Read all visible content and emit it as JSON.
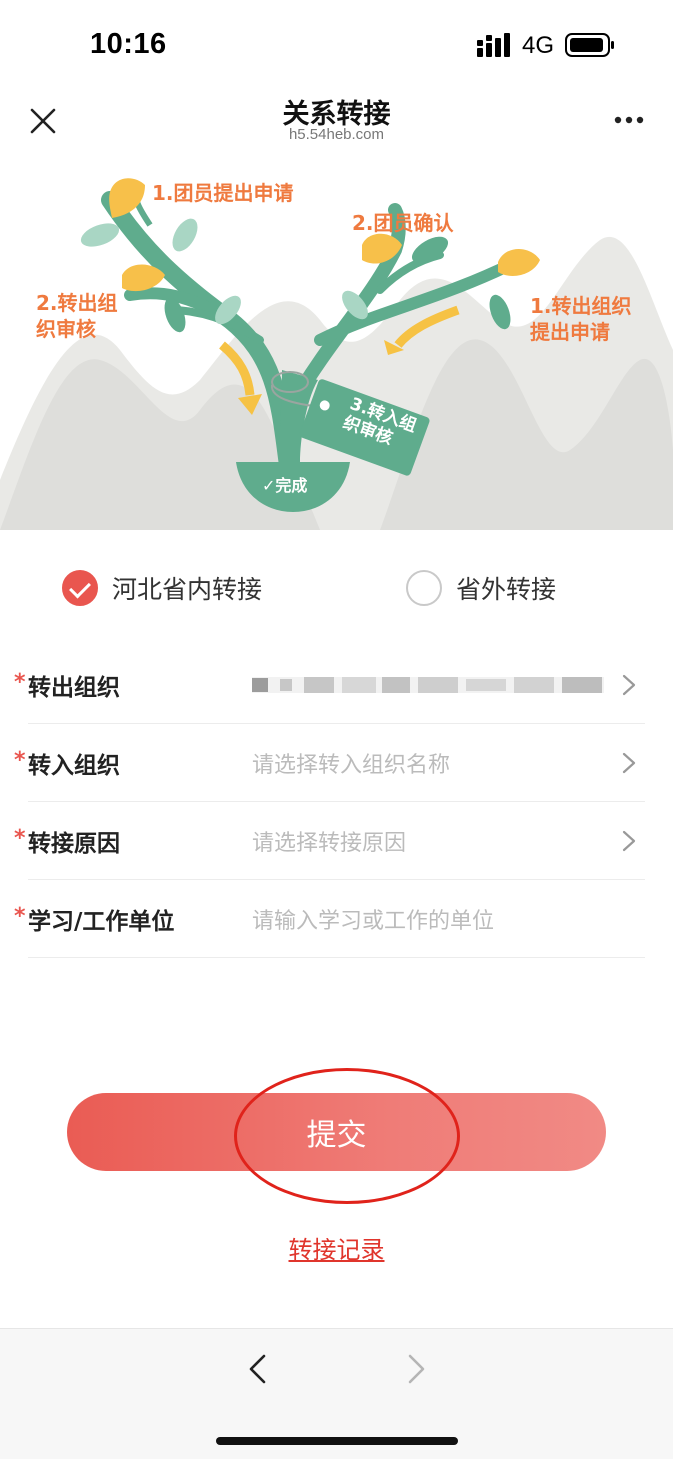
{
  "status_bar": {
    "time": "10:16",
    "network": "4G"
  },
  "nav": {
    "title": "关系转接",
    "subtitle": "h5.54heb.com"
  },
  "banner": {
    "steps": [
      {
        "text": "1.团员提出申请"
      },
      {
        "text": "2.团员确认"
      },
      {
        "text": "2.转出组\n织审核"
      },
      {
        "text": "1.转出组织\n提出申请"
      }
    ],
    "tag": "3.转入组\n织审核",
    "done": "✓完成"
  },
  "transfer_type": {
    "options": [
      {
        "label": "河北省内转接",
        "selected": true
      },
      {
        "label": "省外转接",
        "selected": false
      }
    ]
  },
  "form": {
    "rows": [
      {
        "label": "转出组织",
        "value": "",
        "blurred": true
      },
      {
        "label": "转入组织",
        "placeholder": "请选择转入组织名称"
      },
      {
        "label": "转接原因",
        "placeholder": "请选择转接原因"
      },
      {
        "label": "学习/工作单位",
        "placeholder": "请输入学习或工作的单位"
      }
    ],
    "required_mark": "*"
  },
  "submit_label": "提交",
  "record_link": "转接记录",
  "colors": {
    "accent": "#e9564f",
    "tree": "#5fac8d",
    "orange": "#ef7a3f"
  }
}
